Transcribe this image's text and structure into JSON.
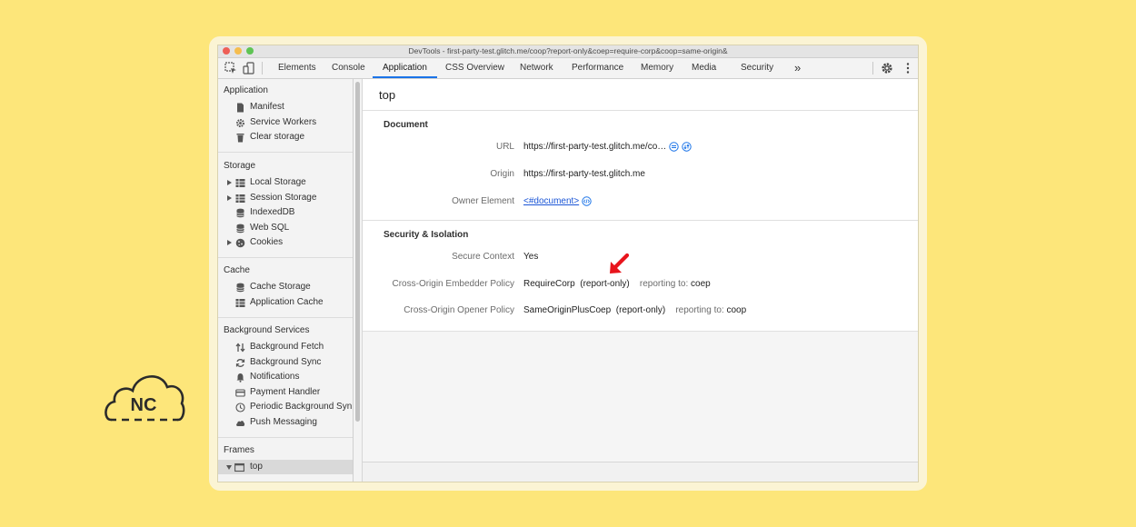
{
  "window": {
    "title": "DevTools - first-party-test.glitch.me/coop?report-only&coep=require-corp&coop=same-origin&"
  },
  "toolbar": {
    "tabs": [
      {
        "label": "Elements"
      },
      {
        "label": "Console"
      },
      {
        "label": "Application",
        "active": true
      },
      {
        "label": "CSS Overview"
      },
      {
        "label": "Network"
      },
      {
        "label": "Performance"
      },
      {
        "label": "Memory"
      },
      {
        "label": "Media"
      },
      {
        "label": "Security"
      }
    ],
    "more_label": "»"
  },
  "sidebar": {
    "sections": [
      {
        "header": "Application",
        "items": [
          "Manifest",
          "Service Workers",
          "Clear storage"
        ]
      },
      {
        "header": "Storage",
        "items": [
          "Local Storage",
          "Session Storage",
          "IndexedDB",
          "Web SQL",
          "Cookies"
        ]
      },
      {
        "header": "Cache",
        "items": [
          "Cache Storage",
          "Application Cache"
        ]
      },
      {
        "header": "Background Services",
        "items": [
          "Background Fetch",
          "Background Sync",
          "Notifications",
          "Payment Handler",
          "Periodic Background Syn",
          "Push Messaging"
        ]
      },
      {
        "header": "Frames",
        "items": [
          "top"
        ]
      }
    ]
  },
  "main": {
    "title": "top",
    "document": {
      "heading": "Document",
      "url_label": "URL",
      "url_value": "https://first-party-test.glitch.me/co…",
      "origin_label": "Origin",
      "origin_value": "https://first-party-test.glitch.me",
      "owner_label": "Owner Element",
      "owner_value": "<#document>"
    },
    "security": {
      "heading": "Security & Isolation",
      "secure_label": "Secure Context",
      "secure_value": "Yes",
      "coep_label": "Cross-Origin Embedder Policy",
      "coep_value": "RequireCorp",
      "coep_mode": "(report-only)",
      "coep_reporting_label": "reporting to:",
      "coep_reporting_value": "coep",
      "coop_label": "Cross-Origin Opener Policy",
      "coop_value": "SameOriginPlusCoep",
      "coop_mode": "(report-only)",
      "coop_reporting_label": "reporting to:",
      "coop_reporting_value": "coop"
    }
  },
  "logo": {
    "text": "NC"
  },
  "colors": {
    "background": "#fde67a",
    "accent": "#1a73e8",
    "arrow": "#e8141c"
  }
}
